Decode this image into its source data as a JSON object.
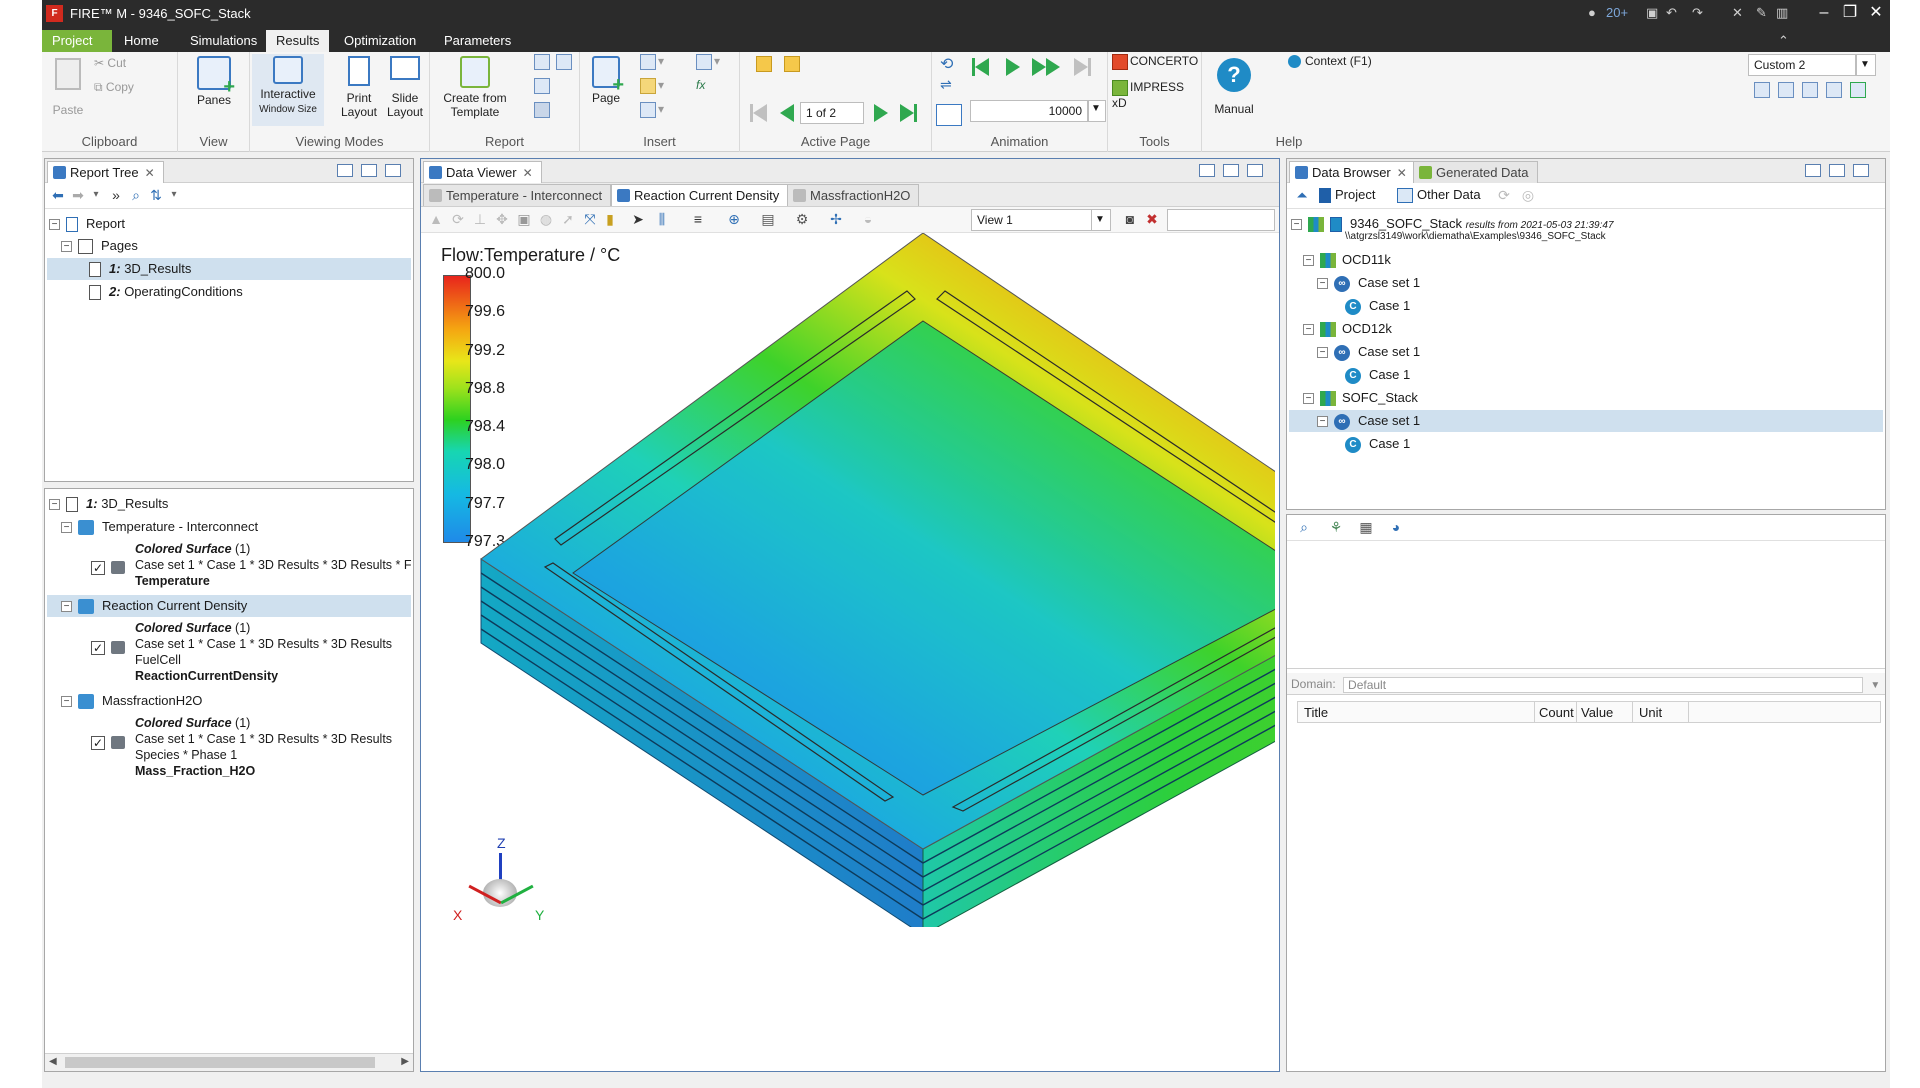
{
  "window": {
    "app_title": "FIRE™ M - 9346_SOFC_Stack",
    "logo_text": "F",
    "counter_badge": "20+"
  },
  "ribbon_tabs": [
    "Project",
    "Home",
    "Simulations",
    "Results",
    "Optimization",
    "Parameters"
  ],
  "ribbon": {
    "clipboard": {
      "paste": "Paste",
      "cut": "Cut",
      "copy": "Copy",
      "label": "Clipboard"
    },
    "view": {
      "panes": "Panes",
      "label": "View"
    },
    "viewing_modes": {
      "interactive": "Interactive",
      "window_size": "Window Size",
      "print_layout": "Print Layout",
      "slide_layout": "Slide Layout",
      "label": "Viewing Modes"
    },
    "report": {
      "create_template": "Create from Template",
      "label": "Report"
    },
    "insert": {
      "page": "Page",
      "label": "Insert"
    },
    "active_page": {
      "page_indicator": "1 of 2",
      "label": "Active Page"
    },
    "animation": {
      "frames": "10000",
      "label": "Animation"
    },
    "tools": {
      "concerto": "CONCERTO",
      "impress": "IMPRESS xD",
      "label": "Tools"
    },
    "help": {
      "manual": "Manual",
      "context": "Context (F1)",
      "label": "Help"
    },
    "layout_select": "Custom 2"
  },
  "report_tree": {
    "tab_label": "Report Tree",
    "root": "Report",
    "pages_label": "Pages",
    "pages": [
      {
        "num": "1:",
        "name": "3D_Results",
        "selected": true
      },
      {
        "num": "2:",
        "name": "OperatingConditions",
        "selected": false
      }
    ]
  },
  "properties": {
    "root_num": "1:",
    "root_name": "3D_Results",
    "items": [
      {
        "name": "Temperature - Interconnect",
        "selected": false,
        "type": "Colored Surface",
        "count": "(1)",
        "path": "Case set 1 * Case 1 * 3D Results * 3D Results * F",
        "extra": "",
        "quantity": "Temperature"
      },
      {
        "name": "Reaction Current Density",
        "selected": true,
        "type": "Colored Surface",
        "count": "(1)",
        "path": "Case set 1 * Case 1 * 3D Results * 3D Results",
        "extra": "FuelCell",
        "quantity": "ReactionCurrentDensity"
      },
      {
        "name": "MassfractionH2O",
        "selected": false,
        "type": "Colored Surface",
        "count": "(1)",
        "path": "Case set 1 * Case 1 * 3D Results * 3D Results",
        "extra": "Species * Phase 1",
        "quantity": "Mass_Fraction_H2O"
      }
    ]
  },
  "data_viewer": {
    "tab_label": "Data Viewer",
    "subtabs": [
      {
        "label": "Temperature - Interconnect",
        "active": false
      },
      {
        "label": "Reaction Current Density",
        "active": true
      },
      {
        "label": "MassfractionH2O",
        "active": false
      }
    ],
    "view_select": "View 1",
    "legend_title": "Flow:Temperature / °C",
    "legend_ticks": [
      "800.0",
      "799.6",
      "799.2",
      "798.8",
      "798.4",
      "798.0",
      "797.7",
      "797.3"
    ],
    "axis": {
      "x": "X",
      "y": "Y",
      "z": "Z"
    }
  },
  "data_browser": {
    "tab_label": "Data Browser",
    "tab2_label": "Generated Data",
    "project_btn": "Project",
    "other_data_btn": "Other Data",
    "root": {
      "name": "9346_SOFC_Stack",
      "results_from": "results from 2021-05-03 21:39:47",
      "path": "\\\\atgrzsl3149\\work\\diematha\\Examples\\9346_SOFC_Stack"
    },
    "nodes": [
      {
        "name": "OCD11k",
        "caseset": "Case set 1",
        "case": "Case 1",
        "caseset_selected": false
      },
      {
        "name": "OCD12k",
        "caseset": "Case set 1",
        "case": "Case 1",
        "caseset_selected": false
      },
      {
        "name": "SOFC_Stack",
        "caseset": "Case set 1",
        "case": "Case 1",
        "caseset_selected": true
      }
    ],
    "domain_label": "Domain:",
    "domain_value": "Default",
    "columns": [
      "Title",
      "Count",
      "Value",
      "Unit"
    ]
  }
}
